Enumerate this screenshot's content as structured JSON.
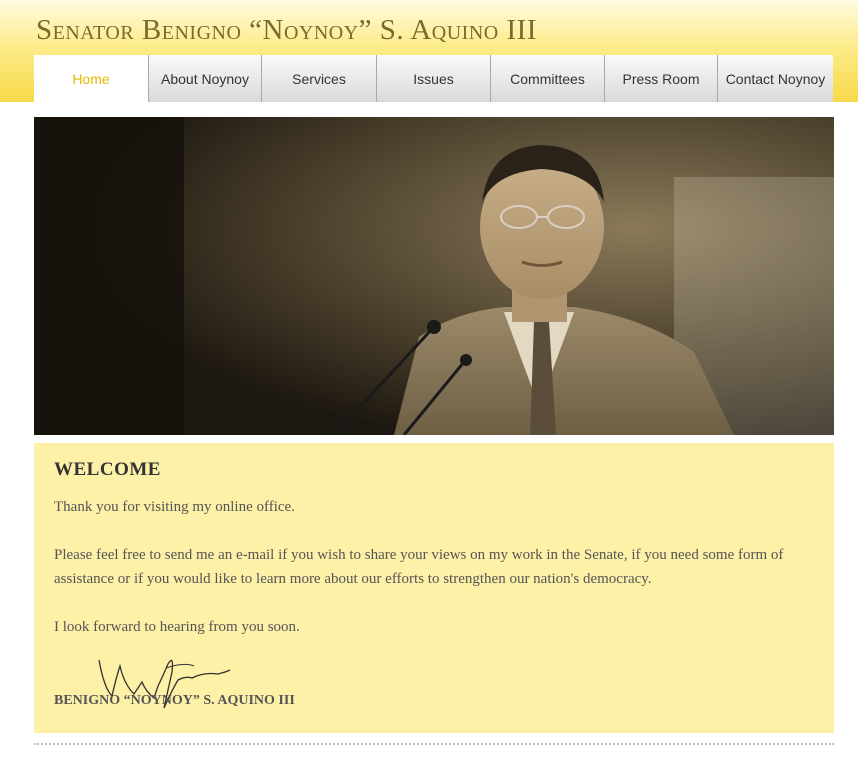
{
  "header": {
    "title": "Senator Benigno “Noynoy” S. Aquino III"
  },
  "nav": {
    "items": [
      {
        "label": "Home"
      },
      {
        "label": "About Noynoy"
      },
      {
        "label": "Services"
      },
      {
        "label": "Issues"
      },
      {
        "label": "Committees"
      },
      {
        "label": "Press Room"
      },
      {
        "label": "Contact Noynoy"
      }
    ],
    "active": "Home"
  },
  "welcome": {
    "title": "WELCOME",
    "paragraphs": [
      "Thank you for visiting my online office.",
      "Please feel free to send me an e-mail if you wish to share your views on my work in the Senate, if you need some form of assistance or if you would like to learn more about our efforts to strengthen our nation's democracy.",
      "I look forward to hearing from you soon."
    ],
    "signature_name": "BENIGNO “NOYNOY” S. AQUINO III"
  },
  "colors": {
    "header_gradient_top": "#fffbe3",
    "header_gradient_bottom": "#f8d94a",
    "active_nav_text": "#e6b800",
    "welcome_background": "#fdf0a7"
  }
}
